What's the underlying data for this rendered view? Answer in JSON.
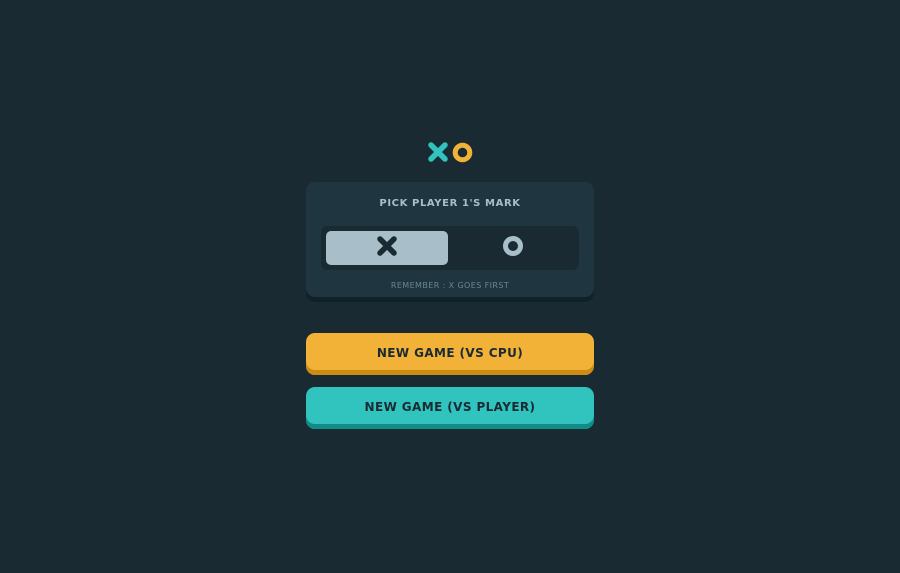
{
  "logo": {
    "x_icon": "x-mark-icon",
    "o_icon": "o-mark-icon",
    "x_color": "#31c3bd",
    "o_color": "#f2b137"
  },
  "pick_panel": {
    "title": "PICK PLAYER 1'S MARK",
    "options": [
      {
        "mark": "X",
        "icon": "x-mark-icon",
        "selected": true
      },
      {
        "mark": "O",
        "icon": "o-mark-icon",
        "selected": false
      }
    ],
    "note": "REMEMBER : X GOES FIRST"
  },
  "buttons": {
    "vs_cpu": "NEW GAME (VS CPU)",
    "vs_player": "NEW GAME (VS PLAYER)"
  },
  "colors": {
    "background": "#1a2a33",
    "panel": "#1f3641",
    "silver": "#a8bfc9",
    "yellow": "#f2b137",
    "teal": "#31c3bd"
  }
}
